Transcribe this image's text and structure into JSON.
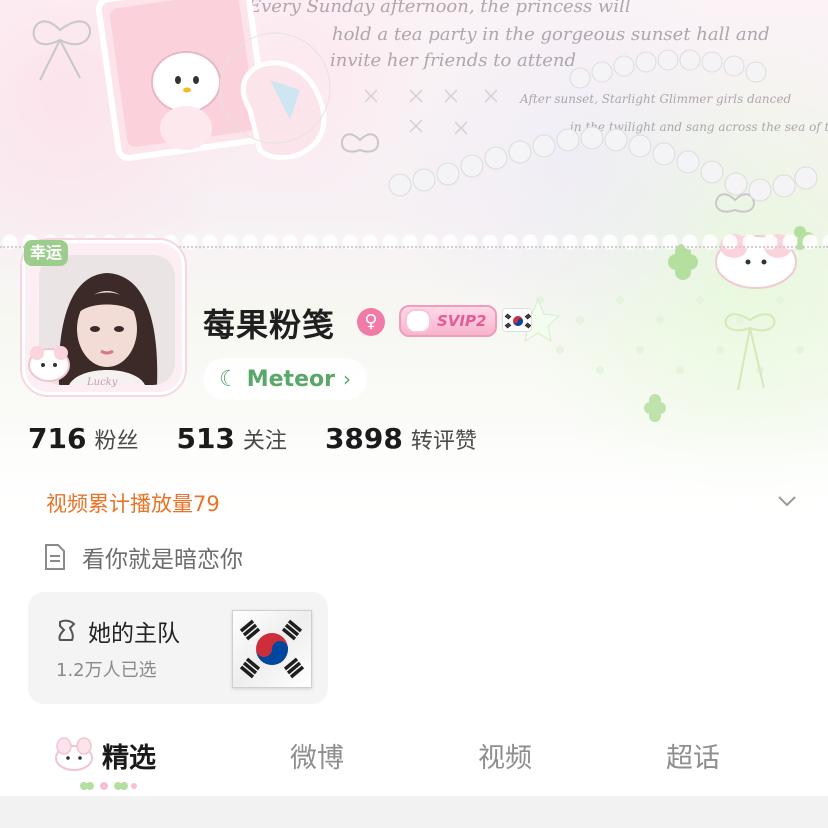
{
  "banner": {
    "line1": "Every Sunday afternoon, the princess will",
    "line2": "hold a tea party in the gorgeous sunset hall and",
    "line3": "invite her friends to attend",
    "line4": "After sunset, Starlight Glimmer girls danced",
    "line5": "in the twilight and sang across the sea of time."
  },
  "avatar": {
    "badge_label": "幸运",
    "frame_label": "Lucky"
  },
  "profile": {
    "name": "莓果粉笺",
    "gender_icon": "female-icon",
    "svip_label": "SVIP2",
    "flag": "south-korea-flag"
  },
  "meteor": {
    "label": "Meteor",
    "chevron": "›"
  },
  "stats": [
    {
      "value": "716",
      "label": "粉丝"
    },
    {
      "value": "513",
      "label": "关注"
    },
    {
      "value": "3898",
      "label": "转评赞"
    }
  ],
  "video_plays": "视频累计播放量79",
  "bio": "看你就是暗恋你",
  "team": {
    "title": "她的主队",
    "subtitle": "1.2万人已选",
    "flag": "south-korea-flag"
  },
  "tabs": [
    {
      "label": "精选",
      "active": true
    },
    {
      "label": "微博",
      "active": false
    },
    {
      "label": "视频",
      "active": false
    },
    {
      "label": "超话",
      "active": false
    }
  ],
  "colors": {
    "accent_green": "#5aa76a",
    "orange": "#e8742a",
    "pink": "#f27aa6"
  }
}
